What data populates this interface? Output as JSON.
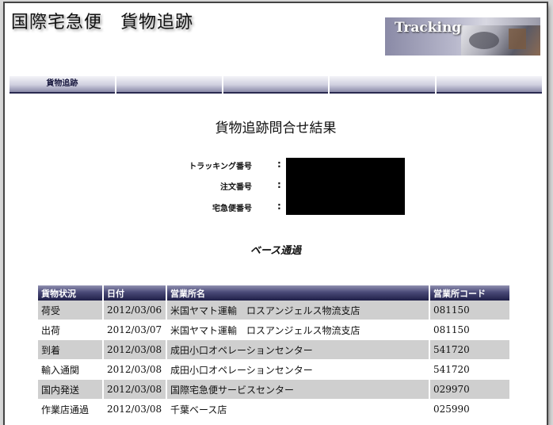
{
  "header": {
    "site_title": "国際宅急便　貨物追跡",
    "banner_text": "Tracking"
  },
  "nav": {
    "items": [
      "貨物追跡",
      "",
      "",
      "",
      ""
    ]
  },
  "main": {
    "heading": "貨物追跡問合せ結果",
    "info": [
      {
        "label": "トラッキング番号",
        "colon": ":"
      },
      {
        "label": "注文番号",
        "colon": ":"
      },
      {
        "label": "宅急便番号",
        "colon": ":"
      }
    ],
    "status_heading": "ベース通過"
  },
  "table": {
    "headers": [
      "貨物状況",
      "日付",
      "営業所名",
      "営業所コード"
    ],
    "rows": [
      [
        "荷受",
        "2012/03/06",
        "米国ヤマト運輸　ロスアンジェルス物流支店",
        "081150"
      ],
      [
        "出荷",
        "2012/03/07",
        "米国ヤマト運輸　ロスアンジェルス物流支店",
        "081150"
      ],
      [
        "到着",
        "2012/03/08",
        "成田小口オペレーションセンター",
        "541720"
      ],
      [
        "輸入通関",
        "2012/03/08",
        "成田小口オペレーションセンター",
        "541720"
      ],
      [
        "国内発送",
        "2012/03/08",
        "国際宅急便サービスセンター",
        "029970"
      ],
      [
        "作業店通過",
        "2012/03/08",
        "千葉ベース店",
        "025990"
      ]
    ]
  }
}
